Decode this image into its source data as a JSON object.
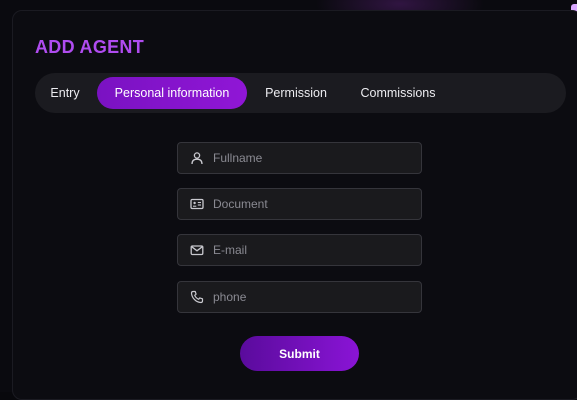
{
  "dialog": {
    "title": "ADD AGENT",
    "accent_color": "#b04cf0"
  },
  "tabs": [
    {
      "label": "Entry",
      "active": false
    },
    {
      "label": "Personal information",
      "active": true
    },
    {
      "label": "Permission",
      "active": false
    },
    {
      "label": "Commissions",
      "active": false
    }
  ],
  "form": {
    "fields": [
      {
        "placeholder": "Fullname",
        "value": "",
        "icon": "user-icon"
      },
      {
        "placeholder": "Document",
        "value": "",
        "icon": "id-card-icon"
      },
      {
        "placeholder": "E-mail",
        "value": "",
        "icon": "mail-icon"
      },
      {
        "placeholder": "phone",
        "value": "",
        "icon": "phone-icon"
      }
    ],
    "submit_label": "Submit"
  }
}
